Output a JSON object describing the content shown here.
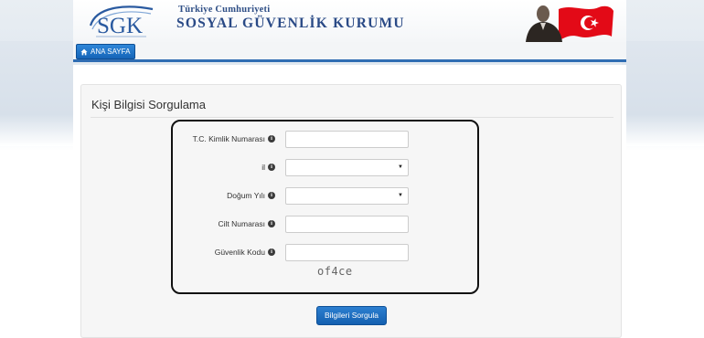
{
  "header": {
    "logo_text": "SGK",
    "subtitle": "Türkiye Cumhuriyeti",
    "title": "SOSYAL GÜVENLİK KURUMU"
  },
  "nav": {
    "home_label": "ANA SAYFA",
    "home_icon": "home-icon"
  },
  "panel": {
    "title": "Kişi Bilgisi Sorgulama"
  },
  "form": {
    "fields": [
      {
        "label": "T.C. Kimlik Numarası",
        "type": "text",
        "value": ""
      },
      {
        "label": "il",
        "type": "select",
        "value": ""
      },
      {
        "label": "Doğum Yılı",
        "type": "select",
        "value": ""
      },
      {
        "label": "Cilt Numarası",
        "type": "text",
        "value": ""
      },
      {
        "label": "Güvenlik Kodu",
        "type": "text",
        "value": ""
      }
    ],
    "captcha": "of4ce",
    "submit_label": "Bilgileri Sorgula"
  },
  "colors": {
    "primary": "#1a6cc0",
    "nav_border": "#2f6db3",
    "title_blue": "#2a4a86",
    "flag_red": "#e30a17"
  }
}
